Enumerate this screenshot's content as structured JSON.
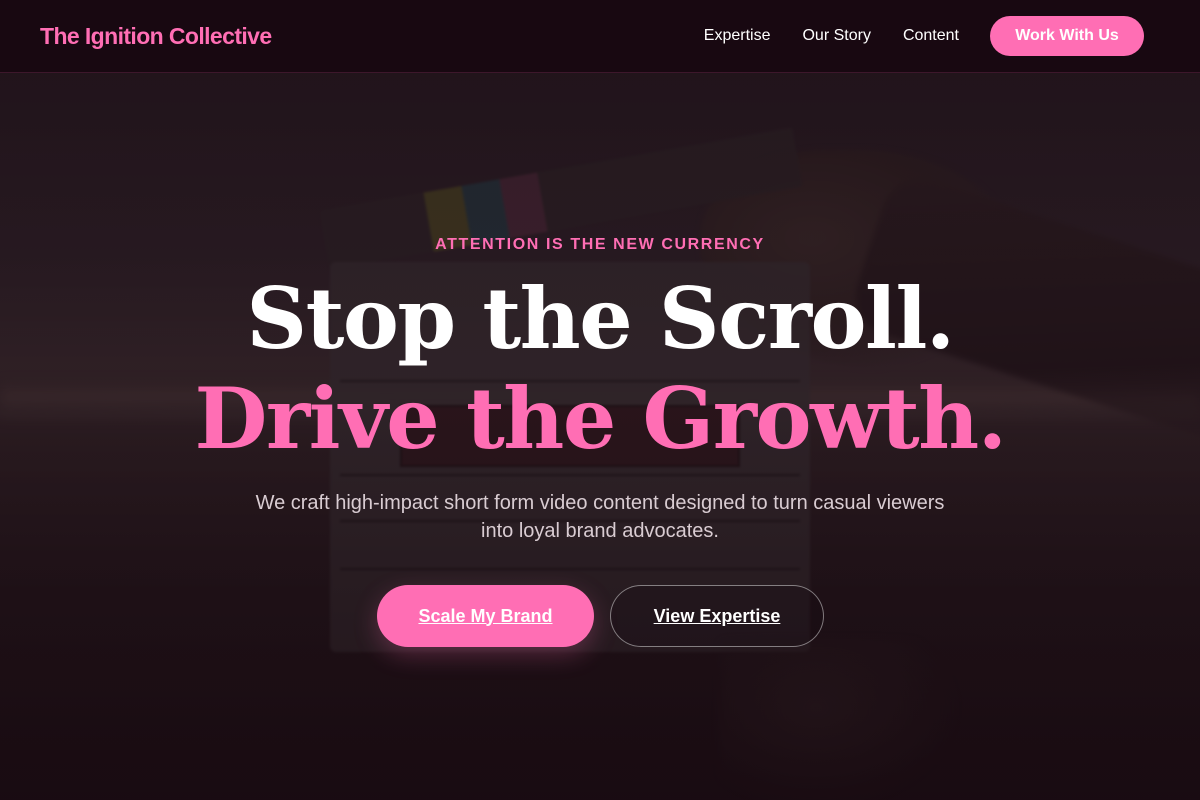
{
  "header": {
    "brand": "The Ignition Collective",
    "nav": [
      {
        "label": "Expertise"
      },
      {
        "label": "Our Story"
      },
      {
        "label": "Content"
      }
    ],
    "cta_label": "Work With Us"
  },
  "hero": {
    "eyebrow": "ATTENTION IS THE NEW CURRENCY",
    "headline_line1": "Stop the Scroll.",
    "headline_line2": "Drive the Growth.",
    "subtitle": "We craft high-impact short form video content designed to turn casual viewers into loyal brand advocates.",
    "primary_button": "Scale My Brand",
    "secondary_button": "View Expertise"
  },
  "colors": {
    "accent": "#ff6eb4",
    "background": "#1a0d14",
    "header_background": "#180810",
    "text": "#ffffff",
    "subtitle_text": "#d9ccd2"
  },
  "background_image": {
    "description_icon": "clapperboard-photo"
  }
}
